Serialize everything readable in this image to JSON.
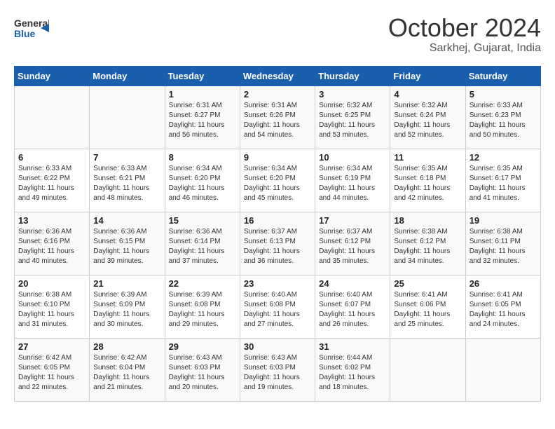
{
  "header": {
    "logo_line1": "General",
    "logo_line2": "Blue",
    "month": "October 2024",
    "location": "Sarkhej, Gujarat, India"
  },
  "weekdays": [
    "Sunday",
    "Monday",
    "Tuesday",
    "Wednesday",
    "Thursday",
    "Friday",
    "Saturday"
  ],
  "weeks": [
    [
      {
        "day": null
      },
      {
        "day": null
      },
      {
        "day": "1",
        "sunrise": "Sunrise: 6:31 AM",
        "sunset": "Sunset: 6:27 PM",
        "daylight": "Daylight: 11 hours and 56 minutes."
      },
      {
        "day": "2",
        "sunrise": "Sunrise: 6:31 AM",
        "sunset": "Sunset: 6:26 PM",
        "daylight": "Daylight: 11 hours and 54 minutes."
      },
      {
        "day": "3",
        "sunrise": "Sunrise: 6:32 AM",
        "sunset": "Sunset: 6:25 PM",
        "daylight": "Daylight: 11 hours and 53 minutes."
      },
      {
        "day": "4",
        "sunrise": "Sunrise: 6:32 AM",
        "sunset": "Sunset: 6:24 PM",
        "daylight": "Daylight: 11 hours and 52 minutes."
      },
      {
        "day": "5",
        "sunrise": "Sunrise: 6:33 AM",
        "sunset": "Sunset: 6:23 PM",
        "daylight": "Daylight: 11 hours and 50 minutes."
      }
    ],
    [
      {
        "day": "6",
        "sunrise": "Sunrise: 6:33 AM",
        "sunset": "Sunset: 6:22 PM",
        "daylight": "Daylight: 11 hours and 49 minutes."
      },
      {
        "day": "7",
        "sunrise": "Sunrise: 6:33 AM",
        "sunset": "Sunset: 6:21 PM",
        "daylight": "Daylight: 11 hours and 48 minutes."
      },
      {
        "day": "8",
        "sunrise": "Sunrise: 6:34 AM",
        "sunset": "Sunset: 6:20 PM",
        "daylight": "Daylight: 11 hours and 46 minutes."
      },
      {
        "day": "9",
        "sunrise": "Sunrise: 6:34 AM",
        "sunset": "Sunset: 6:20 PM",
        "daylight": "Daylight: 11 hours and 45 minutes."
      },
      {
        "day": "10",
        "sunrise": "Sunrise: 6:34 AM",
        "sunset": "Sunset: 6:19 PM",
        "daylight": "Daylight: 11 hours and 44 minutes."
      },
      {
        "day": "11",
        "sunrise": "Sunrise: 6:35 AM",
        "sunset": "Sunset: 6:18 PM",
        "daylight": "Daylight: 11 hours and 42 minutes."
      },
      {
        "day": "12",
        "sunrise": "Sunrise: 6:35 AM",
        "sunset": "Sunset: 6:17 PM",
        "daylight": "Daylight: 11 hours and 41 minutes."
      }
    ],
    [
      {
        "day": "13",
        "sunrise": "Sunrise: 6:36 AM",
        "sunset": "Sunset: 6:16 PM",
        "daylight": "Daylight: 11 hours and 40 minutes."
      },
      {
        "day": "14",
        "sunrise": "Sunrise: 6:36 AM",
        "sunset": "Sunset: 6:15 PM",
        "daylight": "Daylight: 11 hours and 39 minutes."
      },
      {
        "day": "15",
        "sunrise": "Sunrise: 6:36 AM",
        "sunset": "Sunset: 6:14 PM",
        "daylight": "Daylight: 11 hours and 37 minutes."
      },
      {
        "day": "16",
        "sunrise": "Sunrise: 6:37 AM",
        "sunset": "Sunset: 6:13 PM",
        "daylight": "Daylight: 11 hours and 36 minutes."
      },
      {
        "day": "17",
        "sunrise": "Sunrise: 6:37 AM",
        "sunset": "Sunset: 6:12 PM",
        "daylight": "Daylight: 11 hours and 35 minutes."
      },
      {
        "day": "18",
        "sunrise": "Sunrise: 6:38 AM",
        "sunset": "Sunset: 6:12 PM",
        "daylight": "Daylight: 11 hours and 34 minutes."
      },
      {
        "day": "19",
        "sunrise": "Sunrise: 6:38 AM",
        "sunset": "Sunset: 6:11 PM",
        "daylight": "Daylight: 11 hours and 32 minutes."
      }
    ],
    [
      {
        "day": "20",
        "sunrise": "Sunrise: 6:38 AM",
        "sunset": "Sunset: 6:10 PM",
        "daylight": "Daylight: 11 hours and 31 minutes."
      },
      {
        "day": "21",
        "sunrise": "Sunrise: 6:39 AM",
        "sunset": "Sunset: 6:09 PM",
        "daylight": "Daylight: 11 hours and 30 minutes."
      },
      {
        "day": "22",
        "sunrise": "Sunrise: 6:39 AM",
        "sunset": "Sunset: 6:08 PM",
        "daylight": "Daylight: 11 hours and 29 minutes."
      },
      {
        "day": "23",
        "sunrise": "Sunrise: 6:40 AM",
        "sunset": "Sunset: 6:08 PM",
        "daylight": "Daylight: 11 hours and 27 minutes."
      },
      {
        "day": "24",
        "sunrise": "Sunrise: 6:40 AM",
        "sunset": "Sunset: 6:07 PM",
        "daylight": "Daylight: 11 hours and 26 minutes."
      },
      {
        "day": "25",
        "sunrise": "Sunrise: 6:41 AM",
        "sunset": "Sunset: 6:06 PM",
        "daylight": "Daylight: 11 hours and 25 minutes."
      },
      {
        "day": "26",
        "sunrise": "Sunrise: 6:41 AM",
        "sunset": "Sunset: 6:05 PM",
        "daylight": "Daylight: 11 hours and 24 minutes."
      }
    ],
    [
      {
        "day": "27",
        "sunrise": "Sunrise: 6:42 AM",
        "sunset": "Sunset: 6:05 PM",
        "daylight": "Daylight: 11 hours and 22 minutes."
      },
      {
        "day": "28",
        "sunrise": "Sunrise: 6:42 AM",
        "sunset": "Sunset: 6:04 PM",
        "daylight": "Daylight: 11 hours and 21 minutes."
      },
      {
        "day": "29",
        "sunrise": "Sunrise: 6:43 AM",
        "sunset": "Sunset: 6:03 PM",
        "daylight": "Daylight: 11 hours and 20 minutes."
      },
      {
        "day": "30",
        "sunrise": "Sunrise: 6:43 AM",
        "sunset": "Sunset: 6:03 PM",
        "daylight": "Daylight: 11 hours and 19 minutes."
      },
      {
        "day": "31",
        "sunrise": "Sunrise: 6:44 AM",
        "sunset": "Sunset: 6:02 PM",
        "daylight": "Daylight: 11 hours and 18 minutes."
      },
      {
        "day": null
      },
      {
        "day": null
      }
    ]
  ]
}
